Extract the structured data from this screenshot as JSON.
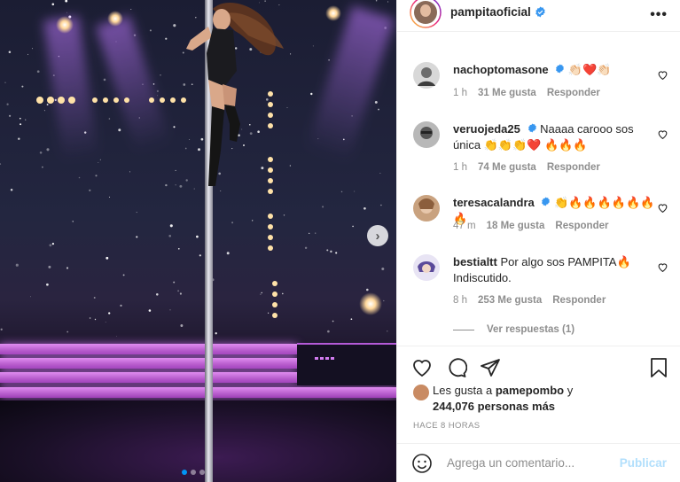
{
  "post": {
    "username": "pampitaoficial",
    "more_icon": "more-options-icon"
  },
  "comments": [
    {
      "user": "nachoptomasone",
      "text": "👏🏻❤️👏🏻",
      "time": "1 h",
      "likes": "31 Me gusta",
      "reply": "Responder"
    },
    {
      "user": "veruojeda25",
      "text": "Naaaa carooo sos única 👏👏👏❤️ 🔥🔥🔥",
      "time": "1 h",
      "likes": "74 Me gusta",
      "reply": "Responder"
    },
    {
      "user": "teresacalandra",
      "text": "👏🔥🔥🔥🔥🔥🔥🔥",
      "time": "47 m",
      "likes": "18 Me gusta",
      "reply": "Responder"
    },
    {
      "user": "bestialtt",
      "text": "Por algo sos PAMPITA🔥 Indiscutido.",
      "time": "8 h",
      "likes": "253 Me gusta",
      "reply": "Responder"
    }
  ],
  "view_replies": "Ver respuestas (1)",
  "likes_line": {
    "prefix": "Les gusta a ",
    "user": "pamepombo",
    "join": " y",
    "count": "244,076 personas más"
  },
  "timestamp": "HACE 8 HORAS",
  "comment_box": {
    "placeholder": "Agrega un comentario...",
    "publish": "Publicar"
  },
  "colors": {
    "verified": "#3897f0",
    "link": "#0095f6",
    "muted": "#8e8e8e",
    "publish_disabled": "#b2dffc"
  }
}
